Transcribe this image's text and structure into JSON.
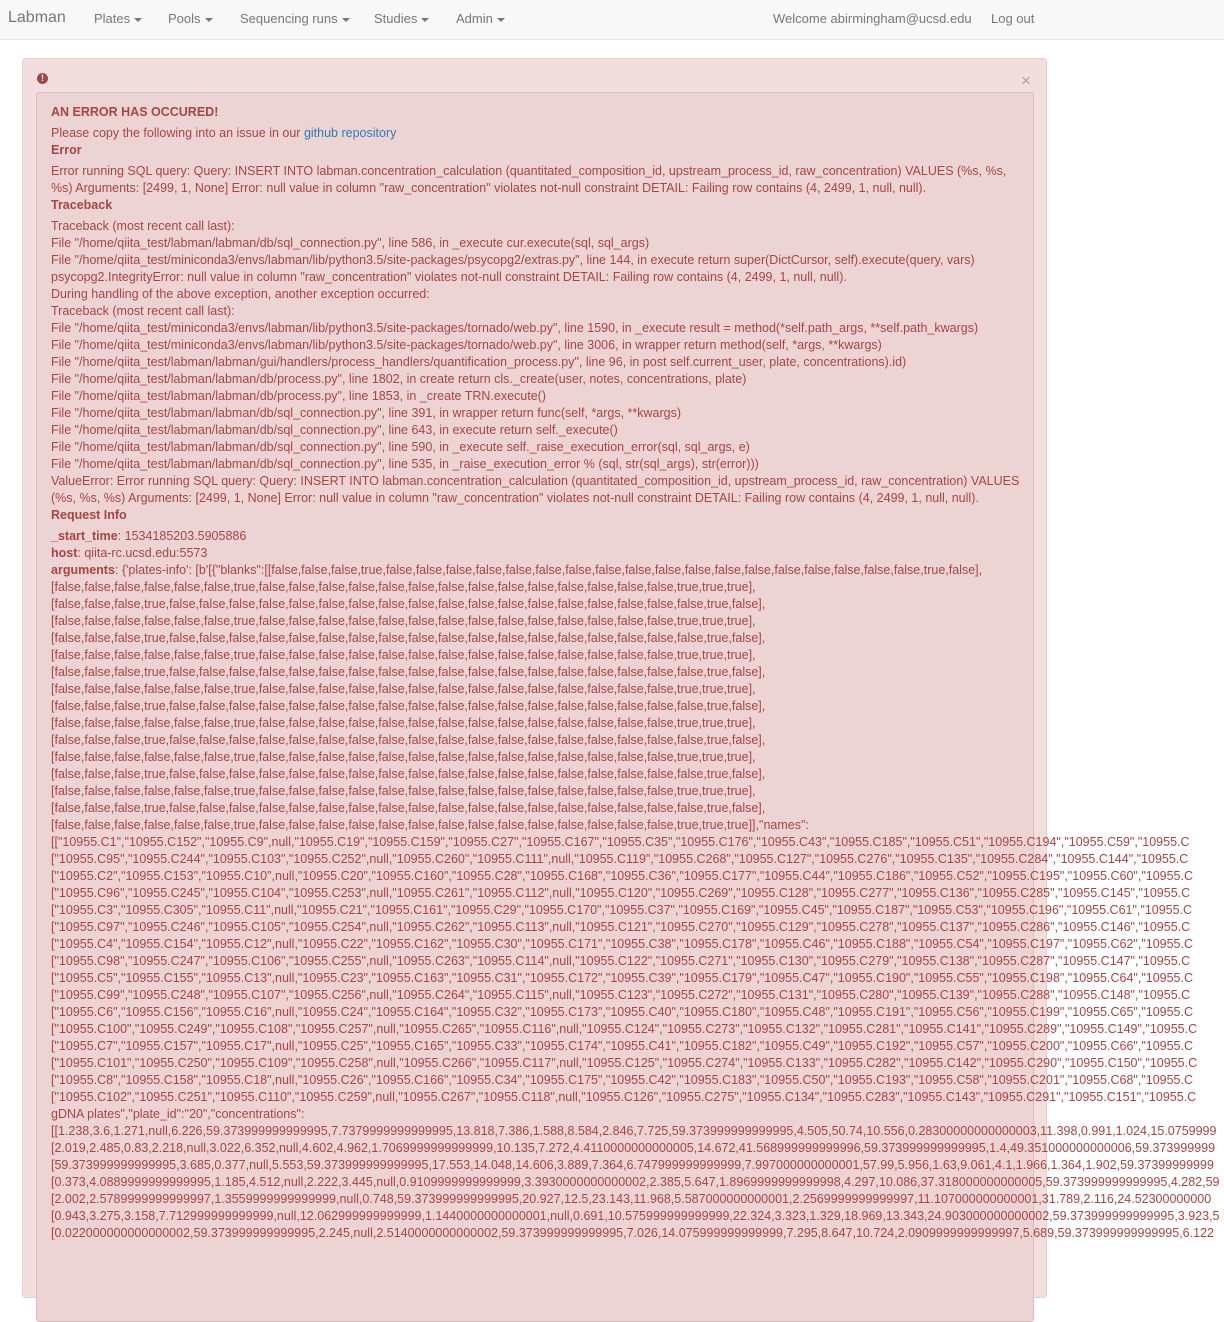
{
  "navbar": {
    "brand": "Labman",
    "menus": [
      "Plates",
      "Pools",
      "Sequencing runs",
      "Studies",
      "Admin"
    ],
    "welcome": "Welcome abirmingham@ucsd.edu",
    "logout": "Log out"
  },
  "alert": {
    "close_glyph": "×",
    "title": "AN ERROR HAS OCCURED!",
    "copy_prefix": "Please copy the following into an issue in our ",
    "copy_link": "github repository",
    "error_heading": "Error",
    "error_text": "Error running SQL query: Query: INSERT INTO labman.concentration_calculation (quantitated_composition_id, upstream_process_id, raw_concentration) VALUES (%s, %s, %s) Arguments: [2499, 1, None] Error: null value in column \"raw_concentration\" violates not-null constraint DETAIL: Failing row contains (4, 2499, 1, null, null).",
    "traceback_heading": "Traceback",
    "traceback_lines": [
      "Traceback (most recent call last):",
      "File \"/home/qiita_test/labman/labman/db/sql_connection.py\", line 586, in _execute cur.execute(sql, sql_args)",
      "File \"/home/qiita_test/miniconda3/envs/labman/lib/python3.5/site-packages/psycopg2/extras.py\", line 144, in execute return super(DictCursor, self).execute(query, vars)",
      "psycopg2.IntegrityError: null value in column \"raw_concentration\" violates not-null constraint DETAIL: Failing row contains (4, 2499, 1, null, null).",
      "During handling of the above exception, another exception occurred:",
      "Traceback (most recent call last):",
      "File \"/home/qiita_test/miniconda3/envs/labman/lib/python3.5/site-packages/tornado/web.py\", line 1590, in _execute result = method(*self.path_args, **self.path_kwargs)",
      "File \"/home/qiita_test/miniconda3/envs/labman/lib/python3.5/site-packages/tornado/web.py\", line 3006, in wrapper return method(self, *args, **kwargs)",
      "File \"/home/qiita_test/labman/labman/gui/handlers/process_handlers/quantification_process.py\", line 96, in post self.current_user, plate, concentrations).id)",
      "File \"/home/qiita_test/labman/labman/db/process.py\", line 1802, in create return cls._create(user, notes, concentrations, plate)",
      "File \"/home/qiita_test/labman/labman/db/process.py\", line 1853, in _create TRN.execute()",
      "File \"/home/qiita_test/labman/labman/db/sql_connection.py\", line 391, in wrapper return func(self, *args, **kwargs)",
      "File \"/home/qiita_test/labman/labman/db/sql_connection.py\", line 643, in execute return self._execute()",
      "File \"/home/qiita_test/labman/labman/db/sql_connection.py\", line 590, in _execute self._raise_execution_error(sql, sql_args, e)",
      "File \"/home/qiita_test/labman/labman/db/sql_connection.py\", line 535, in _raise_execution_error % (sql, str(sql_args), str(error)))"
    ],
    "value_error": "ValueError: Error running SQL query: Query: INSERT INTO labman.concentration_calculation (quantitated_composition_id, upstream_process_id, raw_concentration) VALUES (%s, %s, %s) Arguments: [2499, 1, None] Error: null value in column \"raw_concentration\" violates not-null constraint DETAIL: Failing row contains (4, 2499, 1, null, null).",
    "request_heading": "Request Info",
    "start_time_label": "_start_time",
    "start_time_value": ": 1534185203.5905886",
    "host_label": "host",
    "host_value": ": qiita-rc.ucsd.edu:5573",
    "arguments_label": "arguments",
    "argument_lines": [
      ": {'plates-info': [b'[{\"blanks\":[[false,false,false,true,false,false,false,false,false,false,false,false,false,false,false,false,false,false,false,false,false,false,true,false],",
      "[false,false,false,false,false,false,true,false,false,false,false,false,false,false,false,false,false,false,false,false,false,true,true,true],",
      "[false,false,false,true,false,false,false,false,false,false,false,false,false,false,false,false,false,false,false,false,false,false,true,false],",
      "[false,false,false,false,false,false,true,false,false,false,false,false,false,false,false,false,false,false,false,false,false,true,true,true],",
      "[false,false,false,true,false,false,false,false,false,false,false,false,false,false,false,false,false,false,false,false,false,false,true,false],",
      "[false,false,false,false,false,false,true,false,false,false,false,false,false,false,false,false,false,false,false,false,false,true,true,true],",
      "[false,false,false,true,false,false,false,false,false,false,false,false,false,false,false,false,false,false,false,false,false,false,true,false],",
      "[false,false,false,false,false,false,true,false,false,false,false,false,false,false,false,false,false,false,false,false,false,true,true,true],",
      "[false,false,false,true,false,false,false,false,false,false,false,false,false,false,false,false,false,false,false,false,false,false,true,false],",
      "[false,false,false,false,false,false,true,false,false,false,false,false,false,false,false,false,false,false,false,false,false,true,true,true],",
      "[false,false,false,true,false,false,false,false,false,false,false,false,false,false,false,false,false,false,false,false,false,false,true,false],",
      "[false,false,false,false,false,false,true,false,false,false,false,false,false,false,false,false,false,false,false,false,false,true,true,true],",
      "[false,false,false,true,false,false,false,false,false,false,false,false,false,false,false,false,false,false,false,false,false,false,true,false],",
      "[false,false,false,false,false,false,true,false,false,false,false,false,false,false,false,false,false,false,false,false,false,true,true,true],",
      "[false,false,false,true,false,false,false,false,false,false,false,false,false,false,false,false,false,false,false,false,false,false,true,false],",
      "[false,false,false,false,false,false,true,false,false,false,false,false,false,false,false,false,false,false,false,false,false,true,true,true]],\"names\":",
      "[[\"10955.C1\",\"10955.C152\",\"10955.C9\",null,\"10955.C19\",\"10955.C159\",\"10955.C27\",\"10955.C167\",\"10955.C35\",\"10955.C176\",\"10955.C43\",\"10955.C185\",\"10955.C51\",\"10955.C194\",\"10955.C59\",\"10955.C",
      "[\"10955.C95\",\"10955.C244\",\"10955.C103\",\"10955.C252\",null,\"10955.C260\",\"10955.C111\",null,\"10955.C119\",\"10955.C268\",\"10955.C127\",\"10955.C276\",\"10955.C135\",\"10955.C284\",\"10955.C144\",\"10955.C",
      "[\"10955.C2\",\"10955.C153\",\"10955.C10\",null,\"10955.C20\",\"10955.C160\",\"10955.C28\",\"10955.C168\",\"10955.C36\",\"10955.C177\",\"10955.C44\",\"10955.C186\",\"10955.C52\",\"10955.C195\",\"10955.C60\",\"10955.C",
      "[\"10955.C96\",\"10955.C245\",\"10955.C104\",\"10955.C253\",null,\"10955.C261\",\"10955.C112\",null,\"10955.C120\",\"10955.C269\",\"10955.C128\",\"10955.C277\",\"10955.C136\",\"10955.C285\",\"10955.C145\",\"10955.C",
      "[\"10955.C3\",\"10955.C305\",\"10955.C11\",null,\"10955.C21\",\"10955.C161\",\"10955.C29\",\"10955.C170\",\"10955.C37\",\"10955.C169\",\"10955.C45\",\"10955.C187\",\"10955.C53\",\"10955.C196\",\"10955.C61\",\"10955.C",
      "[\"10955.C97\",\"10955.C246\",\"10955.C105\",\"10955.C254\",null,\"10955.C262\",\"10955.C113\",null,\"10955.C121\",\"10955.C270\",\"10955.C129\",\"10955.C278\",\"10955.C137\",\"10955.C286\",\"10955.C146\",\"10955.C",
      "[\"10955.C4\",\"10955.C154\",\"10955.C12\",null,\"10955.C22\",\"10955.C162\",\"10955.C30\",\"10955.C171\",\"10955.C38\",\"10955.C178\",\"10955.C46\",\"10955.C188\",\"10955.C54\",\"10955.C197\",\"10955.C62\",\"10955.C",
      "[\"10955.C98\",\"10955.C247\",\"10955.C106\",\"10955.C255\",null,\"10955.C263\",\"10955.C114\",null,\"10955.C122\",\"10955.C271\",\"10955.C130\",\"10955.C279\",\"10955.C138\",\"10955.C287\",\"10955.C147\",\"10955.C",
      "[\"10955.C5\",\"10955.C155\",\"10955.C13\",null,\"10955.C23\",\"10955.C163\",\"10955.C31\",\"10955.C172\",\"10955.C39\",\"10955.C179\",\"10955.C47\",\"10955.C190\",\"10955.C55\",\"10955.C198\",\"10955.C64\",\"10955.C",
      "[\"10955.C99\",\"10955.C248\",\"10955.C107\",\"10955.C256\",null,\"10955.C264\",\"10955.C115\",null,\"10955.C123\",\"10955.C272\",\"10955.C131\",\"10955.C280\",\"10955.C139\",\"10955.C288\",\"10955.C148\",\"10955.C",
      "[\"10955.C6\",\"10955.C156\",\"10955.C16\",null,\"10955.C24\",\"10955.C164\",\"10955.C32\",\"10955.C173\",\"10955.C40\",\"10955.C180\",\"10955.C48\",\"10955.C191\",\"10955.C56\",\"10955.C199\",\"10955.C65\",\"10955.C",
      "[\"10955.C100\",\"10955.C249\",\"10955.C108\",\"10955.C257\",null,\"10955.C265\",\"10955.C116\",null,\"10955.C124\",\"10955.C273\",\"10955.C132\",\"10955.C281\",\"10955.C141\",\"10955.C289\",\"10955.C149\",\"10955.C",
      "[\"10955.C7\",\"10955.C157\",\"10955.C17\",null,\"10955.C25\",\"10955.C165\",\"10955.C33\",\"10955.C174\",\"10955.C41\",\"10955.C182\",\"10955.C49\",\"10955.C192\",\"10955.C57\",\"10955.C200\",\"10955.C66\",\"10955.C",
      "[\"10955.C101\",\"10955.C250\",\"10955.C109\",\"10955.C258\",null,\"10955.C266\",\"10955.C117\",null,\"10955.C125\",\"10955.C274\",\"10955.C133\",\"10955.C282\",\"10955.C142\",\"10955.C290\",\"10955.C150\",\"10955.C",
      "[\"10955.C8\",\"10955.C158\",\"10955.C18\",null,\"10955.C26\",\"10955.C166\",\"10955.C34\",\"10955.C175\",\"10955.C42\",\"10955.C183\",\"10955.C50\",\"10955.C193\",\"10955.C58\",\"10955.C201\",\"10955.C68\",\"10955.C",
      "[\"10955.C102\",\"10955.C251\",\"10955.C110\",\"10955.C259\",null,\"10955.C267\",\"10955.C118\",null,\"10955.C126\",\"10955.C275\",\"10955.C134\",\"10955.C283\",\"10955.C143\",\"10955.C291\",\"10955.C151\",\"10955.C",
      "gDNA plates\",\"plate_id\":\"20\",\"concentrations\":",
      "[[1.238,3.6,1.271,null,6.226,59.373999999999995,7.7379999999999995,13.818,7.386,1.588,8.584,2.846,7.725,59.373999999999995,4.505,50.74,10.556,0.28300000000000003,11.398,0.991,1.024,15.0759999",
      "[2.019,2.485,0.83,2.218,null,3.022,6.352,null,4.602,4.962,1.7069999999999999,10.135,7.272,4.4110000000000005,14.672,41.568999999999996,59.373999999999995,1.4,49.351000000000006,59.373999999",
      "[59.373999999999995,3.685,0.377,null,5.553,59.373999999999995,17.553,14.048,14.606,3.889,7.364,6.747999999999999,7.997000000000001,57.99,5.956,1.63,9.061,4.1,1.966,1.364,1.902,59.37399999999",
      "[0.373,4.0889999999999995,1.185,4.512,null,2.222,3.445,null,0.9109999999999999,3.3930000000000002,2.385,5.647,1.8969999999999998,4.297,10.086,37.318000000000005,59.373999999999995,4.282,59",
      "[2.002,2.5789999999999997,1.3559999999999999,null,0.748,59.373999999999995,20.927,12.5,23.143,11.968,5.587000000000001,2.2569999999999997,11.107000000000001,31.789,2.116,24.52300000000",
      "[0.943,3.275,3.158,7.712999999999999,null,12.062999999999999,1.1440000000000001,null,0.691,10.575999999999999,22.324,3.323,1.329,18.969,13.343,24.903000000000002,59.373999999999995,3.923,5",
      "[0.022000000000000002,59.373999999999995,2.245,null,2.5140000000000002,59.373999999999995,7.026,14.075999999999999,7.295,8.647,10.724,2.0909999999999997,5.689,59.373999999999995,6.122"
    ]
  },
  "colors": {
    "navbar_bg": "#f8f8f8",
    "alert_bg": "#f2dede",
    "alert_text": "#a94442",
    "link": "#337ab7"
  }
}
